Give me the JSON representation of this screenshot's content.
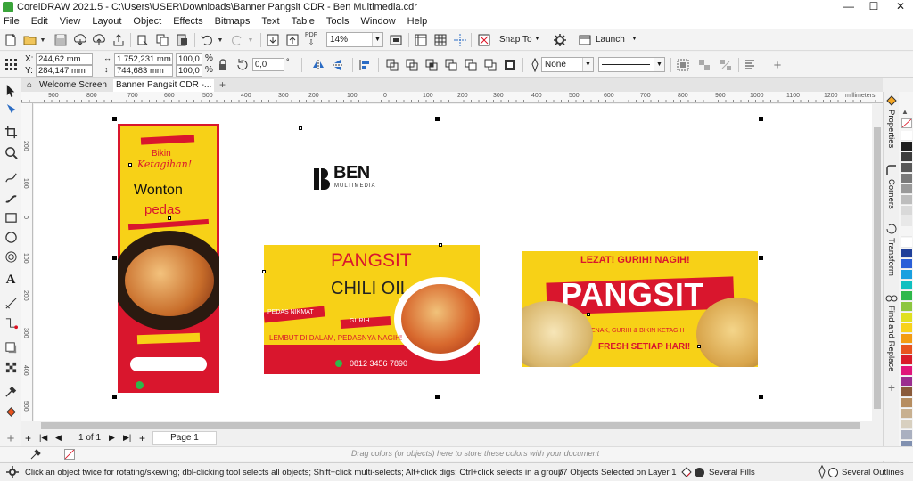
{
  "window": {
    "title": "CorelDRAW 2021.5 - C:\\Users\\USER\\Downloads\\Banner Pangsit CDR - Ben Multimedia.cdr",
    "minimize": "—",
    "maximize": "☐",
    "close": "✕"
  },
  "menu": [
    "File",
    "Edit",
    "View",
    "Layout",
    "Object",
    "Effects",
    "Bitmaps",
    "Text",
    "Table",
    "Tools",
    "Window",
    "Help"
  ],
  "toolbar": {
    "pdf_label": "PDF",
    "zoom": "14%",
    "snap_to": "Snap To",
    "launch": "Launch"
  },
  "property_bar": {
    "x_label": "X:",
    "x": "244,62 mm",
    "y_label": "Y:",
    "y": "284,147 mm",
    "width": "1.752,231 mm",
    "height": "744,683 mm",
    "scale_w": "100,0",
    "scale_h": "100,0",
    "percent": "%",
    "angle": "0,0",
    "outline_width": "None"
  },
  "tabs": {
    "welcome": "Welcome Screen",
    "document": "Banner Pangsit CDR -...",
    "add": "+"
  },
  "ruler": {
    "unit": "millimeters",
    "h_ticks": [
      "900",
      "800",
      "700",
      "600",
      "500",
      "400",
      "300",
      "200",
      "100",
      "0",
      "100",
      "200",
      "300",
      "400",
      "500",
      "600",
      "700",
      "800",
      "900",
      "1000",
      "1100",
      "1200"
    ],
    "v_ticks": [
      "200",
      "100",
      "0",
      "100",
      "200",
      "300",
      "400",
      "500"
    ]
  },
  "artwork": {
    "vertical": {
      "line1": "Bikin",
      "line2": "Ketagihan!",
      "line3": "Wonton",
      "line4": "pedas"
    },
    "logo": {
      "name": "BEN",
      "sub": "MULTIMEDIA"
    },
    "landscape1": {
      "title1": "PANGSIT",
      "title2": "CHILI OIL",
      "tag1": "PEDAS NIKMAT",
      "tag2": "GURIH",
      "tagline": "LEMBUT DI DALAM, PEDASNYA NAGIH!",
      "phone": "0812 3456 7890"
    },
    "landscape2": {
      "top": "LEZAT! GURIH! NAGIH!",
      "title": "PANGSIT",
      "sub": "ENAK, GURIH & BIKIN KETAGIH",
      "bottom": "FRESH SETIAP HARI!"
    }
  },
  "page_nav": {
    "page_count": "1 of 1",
    "page_tab": "Page 1"
  },
  "color_bar": {
    "hint": "Drag colors (or objects) here to store these colors with your document"
  },
  "status": {
    "hint": "Click an object twice for rotating/skewing; dbl-clicking tool selects all objects; Shift+click multi-selects; Alt+click digs; Ctrl+click selects in a group",
    "selection": "77 Objects Selected on Layer 1",
    "fill": "Several Fills",
    "outline": "Several Outlines"
  },
  "docker": {
    "properties": "Properties",
    "corners": "Corners",
    "transform": "Transform",
    "find_replace": "Find and Replace"
  },
  "palette_colors": [
    "#ffffff",
    "#1e1e1e",
    "#3c3c3c",
    "#595959",
    "#7a7a7a",
    "#9a9a9a",
    "#bdbdbd",
    "#d9d9d9",
    "#e8e8e8",
    "#f5f5f5",
    "#ffffff",
    "#1f3f99",
    "#2a5fd8",
    "#1aa0e0",
    "#10c0c0",
    "#2eb84a",
    "#8dc63f",
    "#e0e020",
    "#f8d21a",
    "#f39c12",
    "#e8531e",
    "#d91a2a",
    "#e0157a",
    "#9b2d8f",
    "#8a5a3a",
    "#b68d60",
    "#c8b090",
    "#d8d0c0",
    "#aab0c0",
    "#8090b0"
  ],
  "colors": {
    "brand_red": "#d9162d",
    "banner_yellow": "#f7d117",
    "selection_handle": "#000000"
  }
}
